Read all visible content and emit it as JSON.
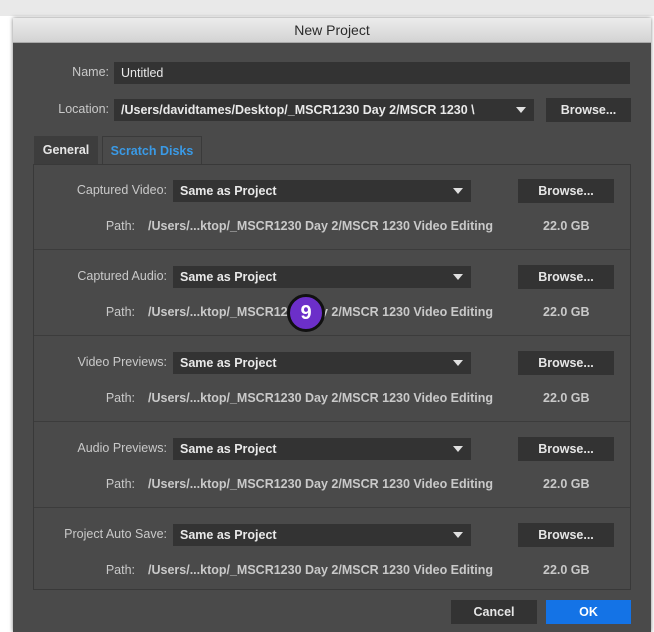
{
  "window": {
    "title": "New Project"
  },
  "project": {
    "name_label": "Name:",
    "name_value": "Untitled",
    "location_label": "Location:",
    "location_value": "/Users/davidtames/Desktop/_MSCR1230 Day 2/MSCR 1230 \\",
    "browse_label": "Browse..."
  },
  "tabs": [
    {
      "label": "General",
      "active": false
    },
    {
      "label": "Scratch Disks",
      "active": true
    }
  ],
  "scratch_disks": [
    {
      "label": "Captured Video:",
      "value": "Same as Project",
      "browse": "Browse...",
      "path_label": "Path:",
      "path": "/Users/...ktop/_MSCR1230 Day 2/MSCR 1230 Video Editing",
      "size": "22.0 GB"
    },
    {
      "label": "Captured Audio:",
      "value": "Same as Project",
      "browse": "Browse...",
      "path_label": "Path:",
      "path": "/Users/...ktop/_MSCR1230 Day 2/MSCR 1230 Video Editing",
      "size": "22.0 GB"
    },
    {
      "label": "Video Previews:",
      "value": "Same as Project",
      "browse": "Browse...",
      "path_label": "Path:",
      "path": "/Users/...ktop/_MSCR1230 Day 2/MSCR 1230 Video Editing",
      "size": "22.0 GB"
    },
    {
      "label": "Audio Previews:",
      "value": "Same as Project",
      "browse": "Browse...",
      "path_label": "Path:",
      "path": "/Users/...ktop/_MSCR1230 Day 2/MSCR 1230 Video Editing",
      "size": "22.0 GB"
    },
    {
      "label": "Project Auto Save:",
      "value": "Same as Project",
      "browse": "Browse...",
      "path_label": "Path:",
      "path": "/Users/...ktop/_MSCR1230 Day 2/MSCR 1230 Video Editing",
      "size": "22.0 GB"
    }
  ],
  "badge": {
    "number": "9",
    "color": "#6c2fc9"
  },
  "footer": {
    "cancel_label": "Cancel",
    "ok_label": "OK"
  },
  "colors": {
    "accent": "#1473e6",
    "tab_active": "#3a9ae6",
    "dialog_bg": "#4a4a4a"
  }
}
